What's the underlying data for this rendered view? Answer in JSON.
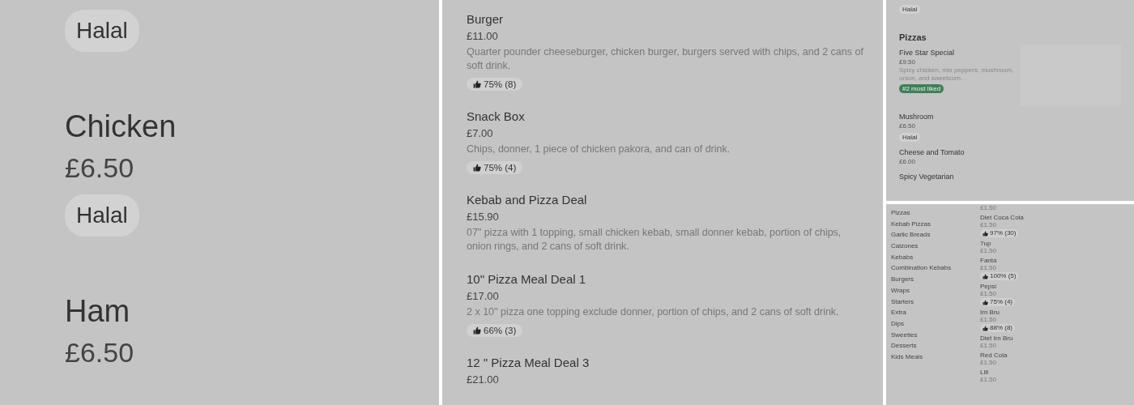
{
  "zoomed_view": {
    "items": [
      {
        "tags": [
          "Halal"
        ]
      },
      {
        "name": "Chicken",
        "price": "£6.50",
        "tags": [
          "Halal"
        ]
      },
      {
        "name": "Ham",
        "price": "£6.50"
      }
    ]
  },
  "deals_view": {
    "items": [
      {
        "name": "Burger",
        "price": "£11.00",
        "description": "Quarter pounder cheeseburger, chicken burger, burgers served with chips, and 2 cans of soft drink.",
        "rating": "75% (8)"
      },
      {
        "name": "Snack Box",
        "price": "£7.00",
        "description": "Chips, donner, 1 piece of chicken pakora, and can of drink.",
        "rating": "75% (4)"
      },
      {
        "name": "Kebab and Pizza Deal",
        "price": "£15.90",
        "description": "07\" pizza with 1 topping, small chicken kebab, small donner kebab, portion of chips, onion rings, and 2 cans of soft drink."
      },
      {
        "name": "10\" Pizza Meal Deal 1",
        "price": "£17.00",
        "description": "2 x 10\" pizza one topping exclude donner, portion of chips, and 2 cans of soft drink.",
        "rating": "66% (3)"
      },
      {
        "name": "12 \" Pizza Meal Deal 3",
        "price": "£21.00"
      }
    ]
  },
  "pizzas_view": {
    "top_tags": [
      "Halal"
    ],
    "section": "Pizzas",
    "items": [
      {
        "name": "Five Star Special",
        "price": "£9.50",
        "description": "Spicy chicken, mix peppers, mushroom, onion, and sweetcorn.",
        "badge": "#2 most liked",
        "has_image": true
      },
      {
        "name": "Mushroom",
        "price": "£6.50",
        "tags": [
          "Halal"
        ],
        "has_image": false
      },
      {
        "name": "Cheese and Tomato",
        "price": "£6.00",
        "has_image": false
      },
      {
        "name": "Spicy Vegetarian",
        "has_image": false
      }
    ]
  },
  "drinks_view": {
    "categories": [
      "Pizzas",
      "Kebab Pizzas",
      "Garlic Breads",
      "Calzones",
      "Kebabs",
      "Combination Kebabs",
      "Burgers",
      "Wraps",
      "Starters",
      "Extra",
      "Dips",
      "Sweeties",
      "Desserts",
      "Kids Meals"
    ],
    "items": [
      {
        "price": "£1.50"
      },
      {
        "name": "Diet Coca Cola",
        "price": "£1.50",
        "rating": "97% (30)"
      },
      {
        "name": "7up",
        "price": "£1.50"
      },
      {
        "name": "Fanta",
        "price": "£1.50",
        "rating": "100% (5)"
      },
      {
        "name": "Pepsi",
        "price": "£1.50",
        "rating": "75% (4)"
      },
      {
        "name": "Irn Bru",
        "price": "£1.50",
        "rating": "88% (8)"
      },
      {
        "name": "Diet Irn Bru",
        "price": "£1.50"
      },
      {
        "name": "Red Cola",
        "price": "£1.50"
      },
      {
        "name": "Lilt",
        "price": "£1.50"
      }
    ]
  }
}
